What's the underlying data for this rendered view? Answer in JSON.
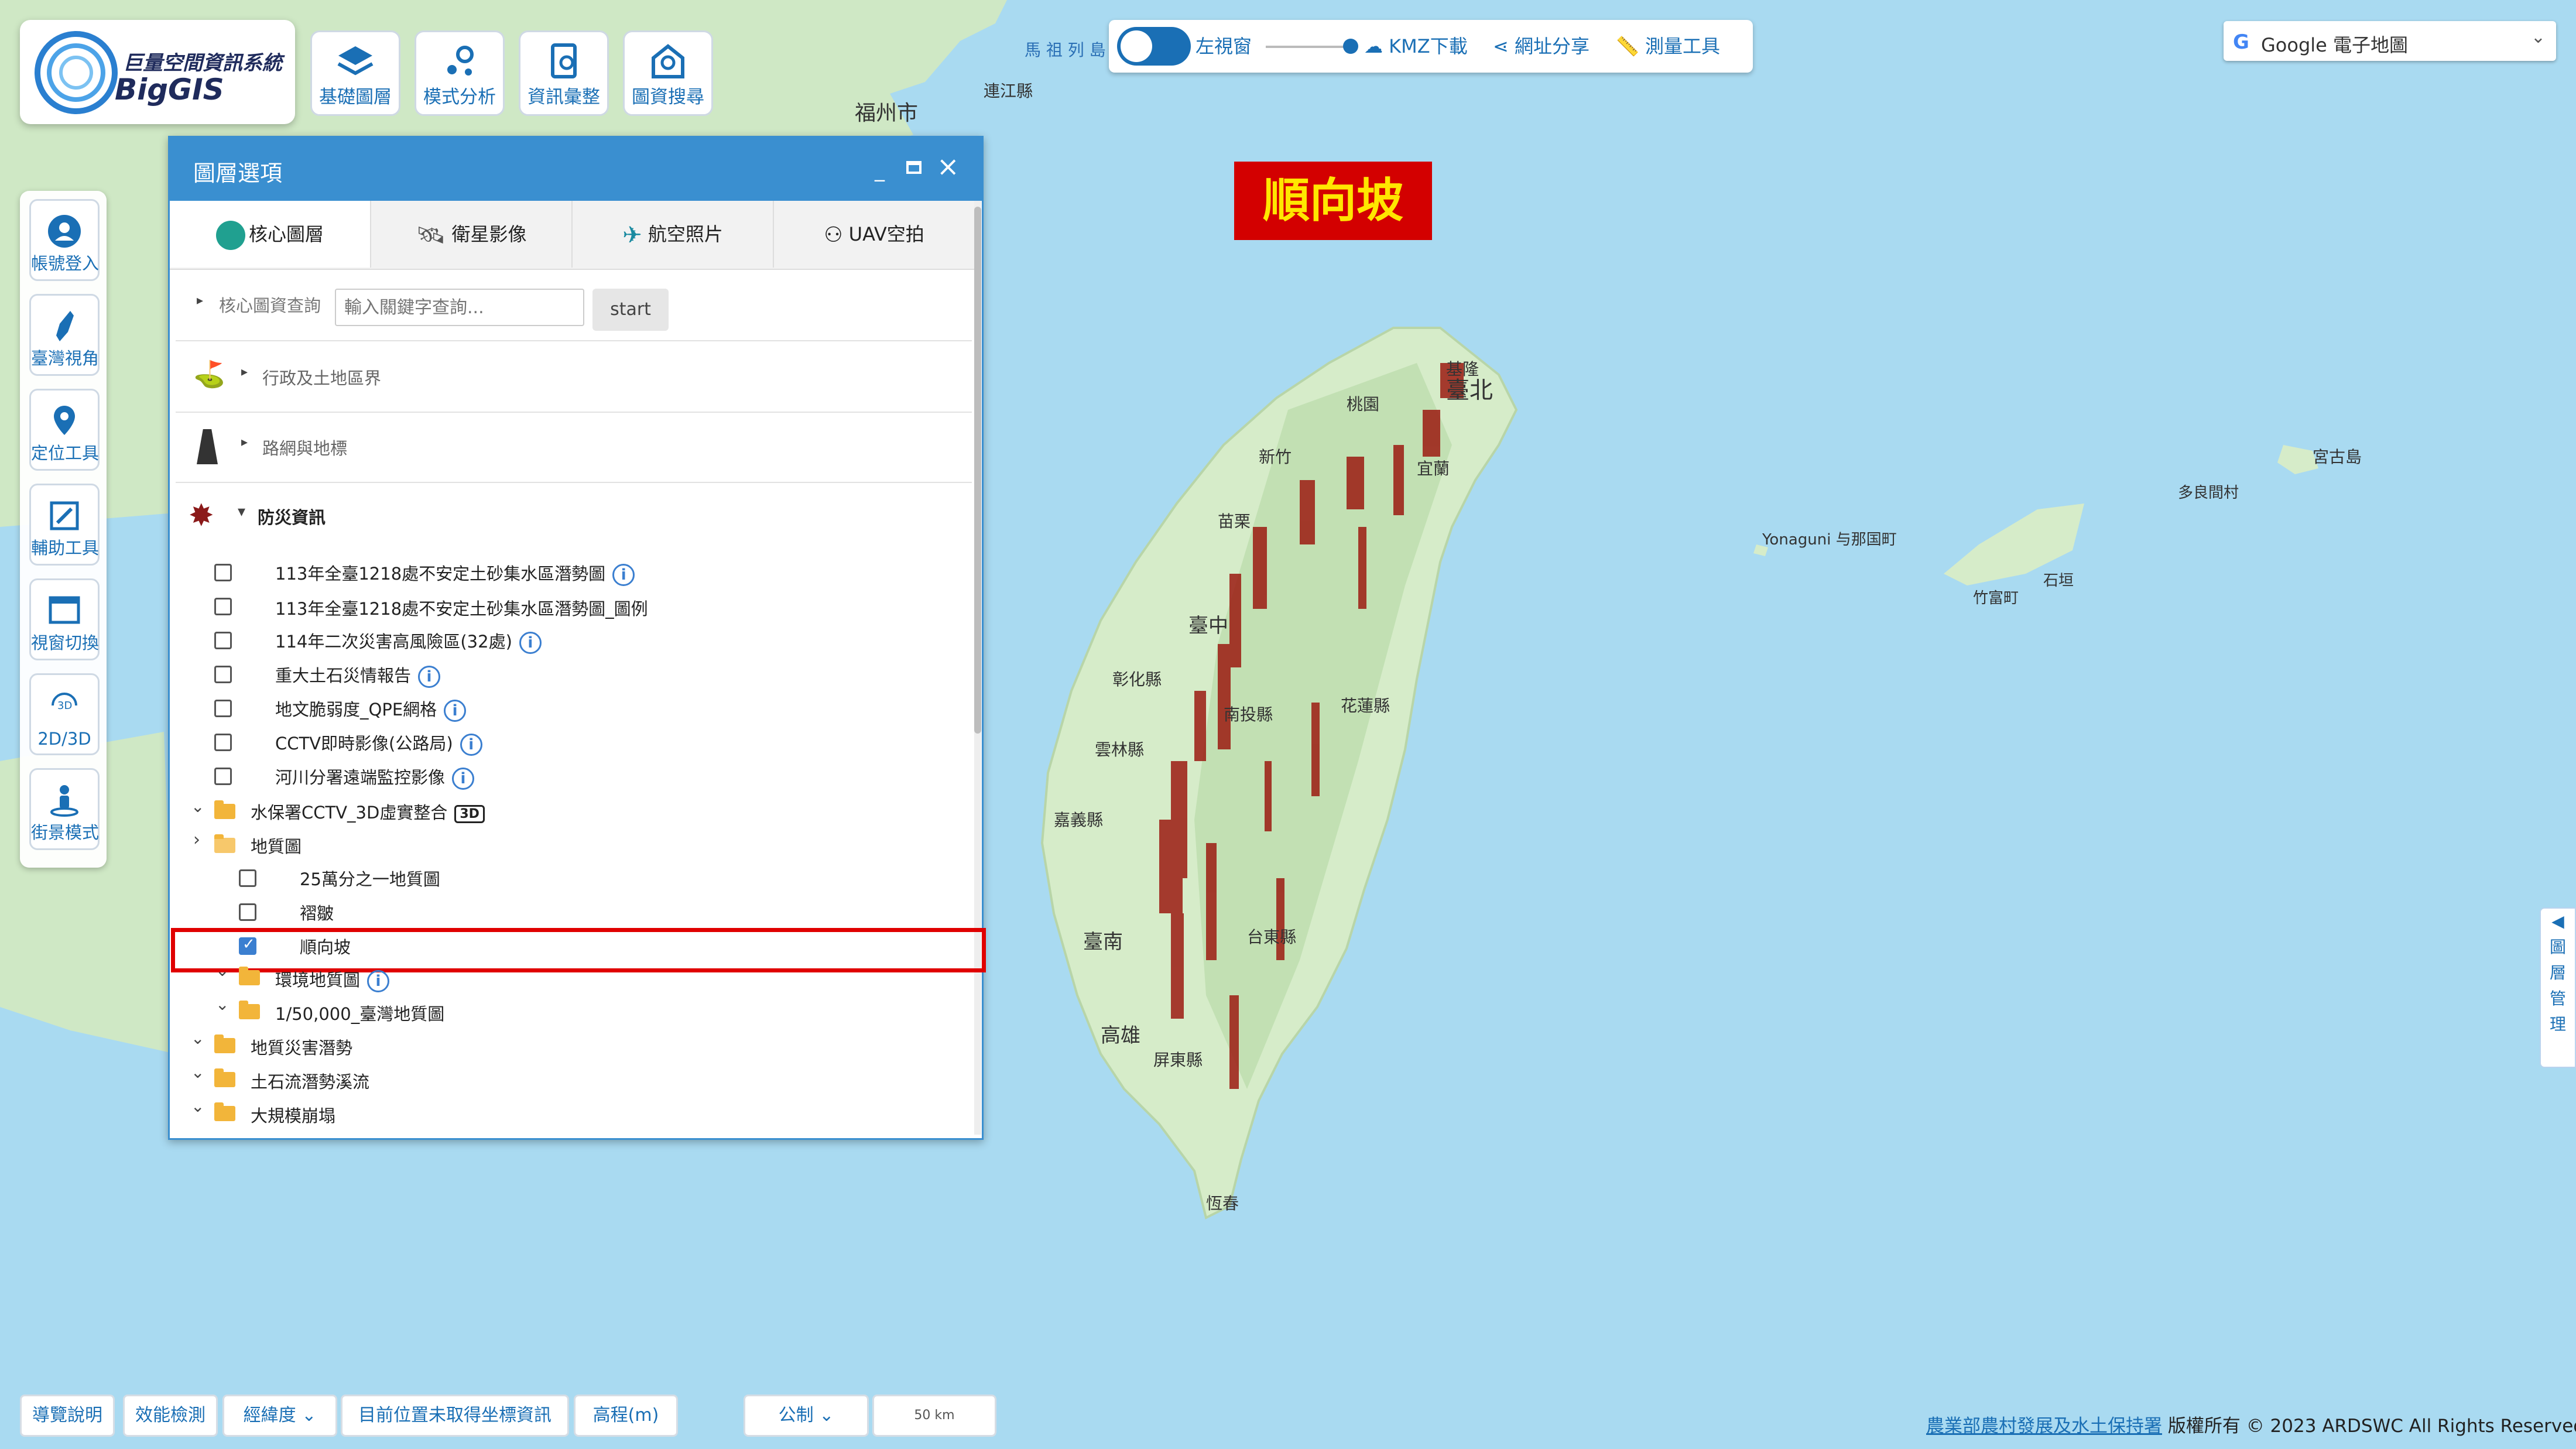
{
  "logo": {
    "title": "巨量空間資訊系統",
    "brand": "BigGIS"
  },
  "top_buttons": [
    {
      "label": "基礎圖層",
      "icon": "layers-icon"
    },
    {
      "label": "模式分析",
      "icon": "analysis-icon"
    },
    {
      "label": "資訊彙整",
      "icon": "report-icon"
    },
    {
      "label": "圖資搜尋",
      "icon": "search-map-icon"
    }
  ],
  "toolbar": {
    "left_view": "左視窗",
    "kmz": "KMZ下載",
    "share": "網址分享",
    "measure": "測量工具"
  },
  "basemap_select": {
    "value": "Google 電子地圖"
  },
  "sidebar": [
    {
      "label": "帳號登入",
      "icon": "user-icon"
    },
    {
      "label": "臺灣視角",
      "icon": "taiwan-icon"
    },
    {
      "label": "定位工具",
      "icon": "location-pin-icon"
    },
    {
      "label": "輔助工具",
      "icon": "tools-icon"
    },
    {
      "label": "視窗切換",
      "icon": "window-icon"
    },
    {
      "label": "2D/3D",
      "icon": "3d-icon"
    },
    {
      "label": "街景模式",
      "icon": "streetview-icon"
    }
  ],
  "panel": {
    "title": "圖層選項",
    "tabs": [
      "核心圖層",
      "衛星影像",
      "航空照片",
      "UAV空拍"
    ],
    "search_label": "核心圖資查詢",
    "search_placeholder": "輸入關鍵字查詢...",
    "search_button": "start",
    "sections": [
      "行政及土地區界",
      "路網與地標",
      "防災資訊"
    ],
    "disaster_items": [
      {
        "label": "113年全臺1218處不安定土砂集水區潛勢圖",
        "info": true
      },
      {
        "label": "113年全臺1218處不安定土砂集水區潛勢圖_圖例",
        "info": false
      },
      {
        "label": "114年二次災害高風險區(32處)",
        "info": true
      },
      {
        "label": "重大土石災情報告",
        "info": true
      },
      {
        "label": "地文脆弱度_QPE網格",
        "info": true
      },
      {
        "label": "CCTV即時影像(公路局)",
        "info": true
      },
      {
        "label": "河川分署遠端監控影像",
        "info": true
      }
    ],
    "cctv_folder": "水保署CCTV_3D虛實整合",
    "cctv_badge": "3D",
    "geo_folder": "地質圖",
    "geo_items": [
      "25萬分之一地質圖",
      "褶皺",
      "順向坡"
    ],
    "env_folder": "環境地質圖",
    "map50k_folder": "1/50,000_臺灣地質圖",
    "folders_more": [
      "地質災害潛勢",
      "土石流潛勢溪流",
      "大規模崩塌"
    ]
  },
  "highlight_badge": "順向坡",
  "map_labels": {
    "taipei": "臺北",
    "keelung": "基隆",
    "taoyuan": "桃園",
    "hsinchu": "新竹",
    "yilan": "宜蘭",
    "miaoli": "苗栗",
    "taichung": "臺中",
    "changhua": "彰化縣",
    "nantou": "南投縣",
    "yunlin": "雲林縣",
    "chiayi": "嘉義縣",
    "tainan": "臺南",
    "kaohsiung": "高雄",
    "pingtung": "屏東縣",
    "taitung": "台東縣",
    "hualien": "花蓮縣",
    "hengchun": "恆春",
    "fuzhou": "福州市",
    "yonaguni": "Yonaguni\n与那国町",
    "miyako": "宮古島",
    "taketomi": "竹富町",
    "ishigaki": "石垣",
    "tarama": "多良間村",
    "lianjiang": "連江縣",
    "matsu": "馬 祖 列 島"
  },
  "right_tab": [
    "◀",
    "圖",
    "層",
    "管",
    "理"
  ],
  "bottom": {
    "guide": "導覽說明",
    "perf": "效能檢測",
    "coord": "經緯度",
    "position": "目前位置未取得坐標資訊",
    "elevation": "高程(m)",
    "unit": "公制",
    "scale": "50 km"
  },
  "copyright": {
    "org": "農業部農村發展及水土保持署",
    "text": " 版權所有 © 2023 ARDSWC All Rights Reserved."
  }
}
